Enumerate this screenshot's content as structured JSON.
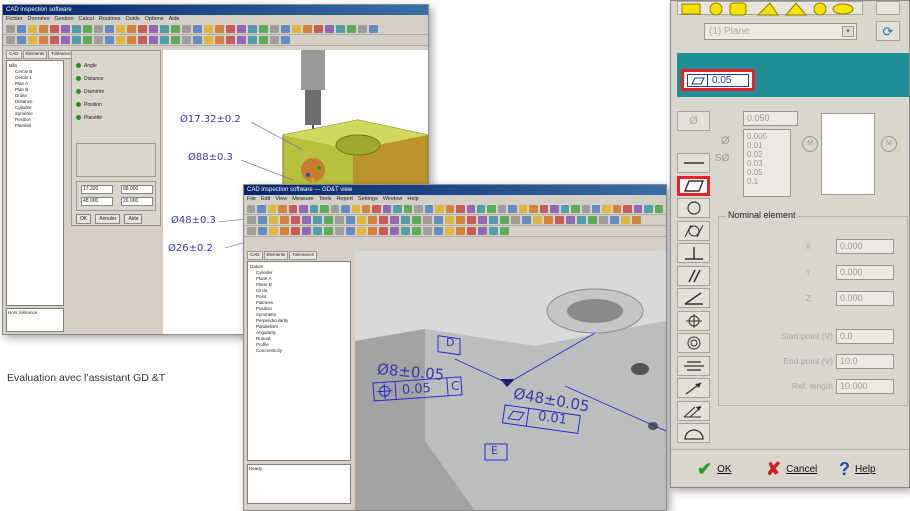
{
  "caption": "Evaluation avec l’assistant GD &T",
  "window1": {
    "title": "CAD inspection software",
    "menu": [
      "Fichier",
      "Données",
      "Gestion",
      "Calcul",
      "Routines",
      "Outils",
      "Options",
      "Aide"
    ],
    "tree_tabs": [
      "CAD",
      "Elements",
      "Tolérances"
    ],
    "tree_items": [
      "Bâti",
      "Cercle B",
      "Cercle 1",
      "Plan A",
      "Plan B",
      "Droite",
      "Distance",
      "Cylindre",
      "Symétrie",
      "Position",
      "Planéité"
    ],
    "status": "Hors tolérance",
    "panel_rows": [
      "Angle",
      "Distance",
      "Diamètre",
      "Position",
      "Planéité"
    ],
    "panel_values": [
      "17.320",
      "88.000",
      "48.000",
      "26.000"
    ],
    "panel_buttons": [
      "OK",
      "Annuler",
      "Aide"
    ],
    "dims": [
      "Ø17.32±0.2",
      "Ø88±0.3",
      "Ø48±0.3",
      "Ø26±0.2"
    ]
  },
  "window2": {
    "title": "CAD inspection software — GD&T view",
    "menu": [
      "File",
      "Edit",
      "View",
      "Measure",
      "Tools",
      "Report",
      "Settings",
      "Window",
      "Help"
    ],
    "tree_tabs": [
      "CAD",
      "Elements",
      "Tolerances"
    ],
    "tree_items": [
      "Datum",
      "Cylinder",
      "Plane A",
      "Plane B",
      "Circle",
      "Point",
      "Flatness",
      "Position",
      "Symmetry",
      "Perpendicularity",
      "Parallelism",
      "Angularity",
      "Runout",
      "Profile",
      "Concentricity"
    ],
    "status": "Ready",
    "dims": {
      "datum_d": "D",
      "datum_e": "E",
      "hole_dim": "Ø8±0.05",
      "pos_tol": "0.05",
      "pos_ref": "C",
      "bore_dim": "Ø48±0.05",
      "flat_tol": "0.01"
    }
  },
  "dialog": {
    "combo_value": "(1) Plane",
    "tolerance_value": "0.05",
    "tol_field_value": "0.050",
    "tol_list": [
      "0.005",
      "0.01",
      "0.02",
      "0.03",
      "0.05",
      "0.1"
    ],
    "modifier": "M",
    "nominal_label": "Nominal element",
    "x_label": "X",
    "x_value": "0.000",
    "y_label": "Y",
    "y_value": "0.000",
    "z_label": "Z",
    "z_value": "0.000",
    "start_label": "Start point (V)",
    "start_value": "0.0",
    "end_label": "End point (V)",
    "end_value": "10.0",
    "ref_label": "Ref. length",
    "ref_value": "10.000",
    "ok_label": "OK",
    "cancel_label": "Cancel",
    "help_label": "Help",
    "colors": {
      "accent_yellow": "#f2e300",
      "header_teal": "#1e8f95",
      "highlight_red": "#e8202a"
    }
  }
}
